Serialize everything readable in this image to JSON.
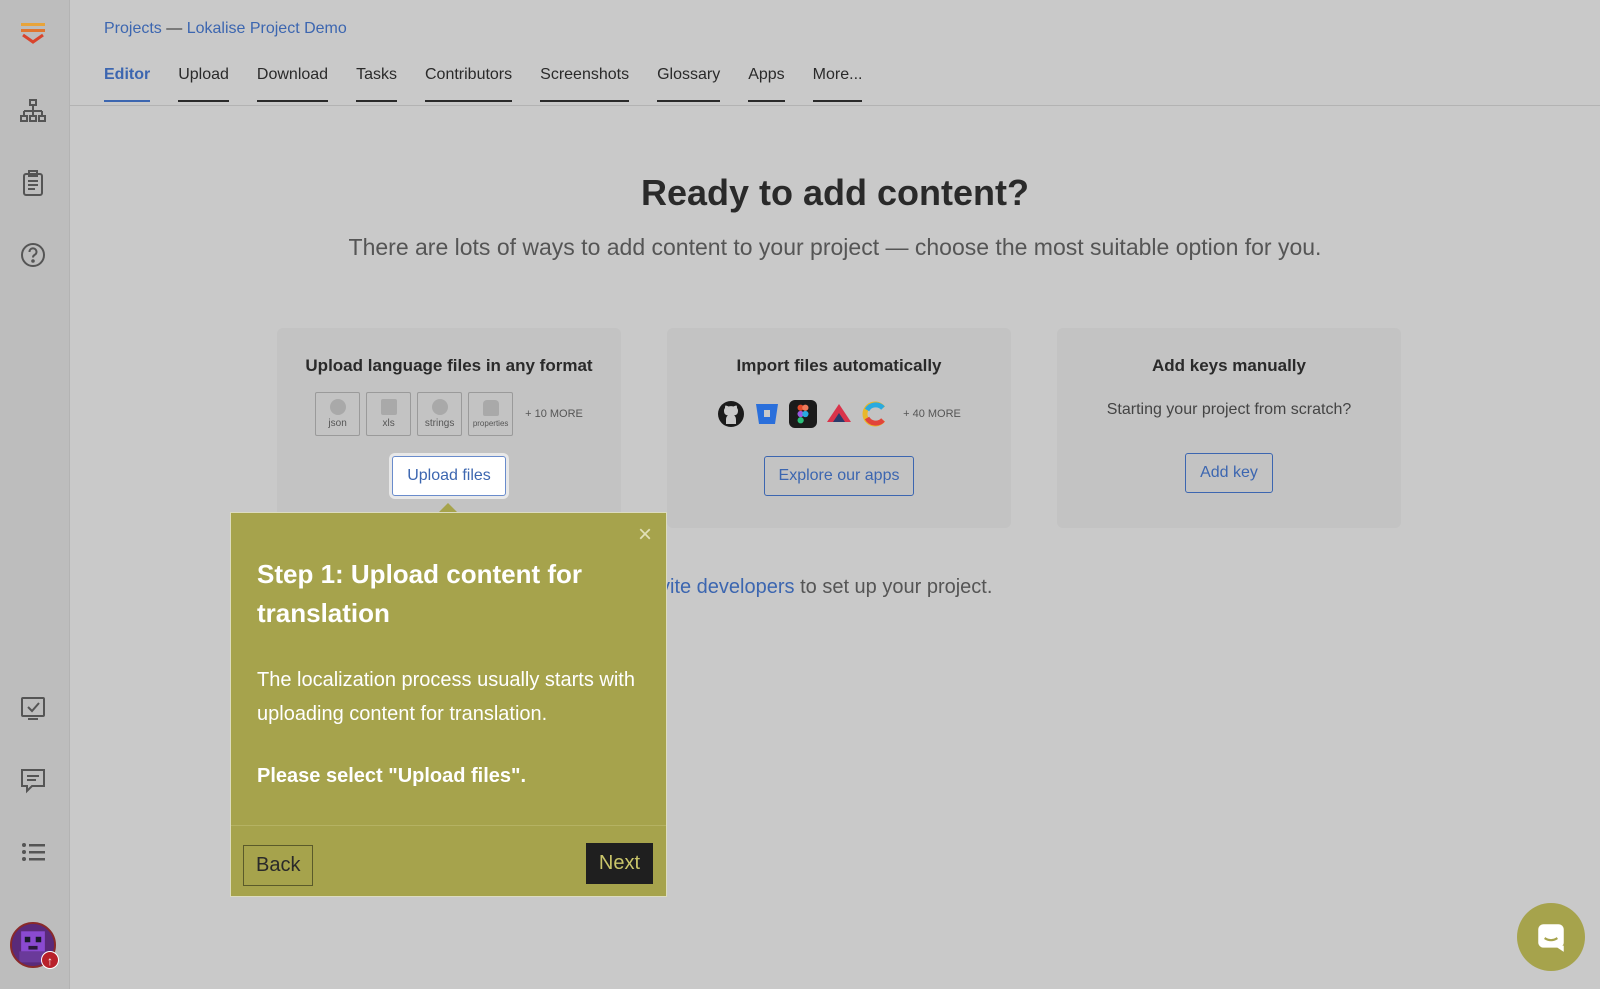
{
  "breadcrumb": {
    "projects": "Projects",
    "separator": " — ",
    "project_name": "Lokalise Project Demo"
  },
  "tabs": [
    {
      "label": "Editor",
      "active": true
    },
    {
      "label": "Upload"
    },
    {
      "label": "Download"
    },
    {
      "label": "Tasks"
    },
    {
      "label": "Contributors"
    },
    {
      "label": "Screenshots"
    },
    {
      "label": "Glossary"
    },
    {
      "label": "Apps"
    },
    {
      "label": "More..."
    }
  ],
  "hero": {
    "title": "Ready to add content?",
    "subtitle": "There are lots of ways to add content to your project — choose the most suitable option for you."
  },
  "cards": {
    "upload": {
      "title": "Upload language files in any format",
      "formats": [
        "json",
        "xls",
        "strings",
        "properties"
      ],
      "more": "+ 10 MORE",
      "button": "Upload files"
    },
    "import": {
      "title": "Import files automatically",
      "apps": [
        "github-icon",
        "bitbucket-icon",
        "figma-icon",
        "contentful-icon",
        "c-logo-icon"
      ],
      "more": "+ 40 MORE",
      "button": "Explore our apps"
    },
    "manual": {
      "title": "Add keys manually",
      "text": "Starting your project from scratch?",
      "button": "Add key"
    }
  },
  "invite": {
    "link": "vite developers",
    "rest": " to set up your project."
  },
  "popup": {
    "close": "×",
    "title": "Step 1: Upload content for translation",
    "body": "The localization process usually starts with uploading content for translation.",
    "cta": "Please select \"Upload files\".",
    "back": "Back",
    "next": "Next"
  },
  "avatar_badge": "↑",
  "colors": {
    "accent": "#3c66b0",
    "tour": "#a6a34c",
    "logo_top": "#e8a43a",
    "logo_bottom": "#d9442c"
  }
}
